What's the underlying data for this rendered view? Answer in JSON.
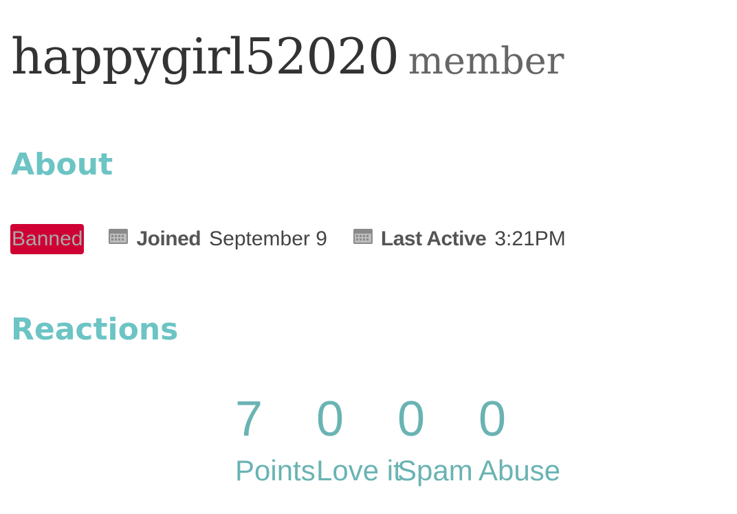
{
  "profile": {
    "username": "happygirl52020",
    "role": "member"
  },
  "about": {
    "title": "About",
    "badge": "Banned",
    "joined_label": "Joined",
    "joined_value": "September 9",
    "last_active_label": "Last Active",
    "last_active_value": "3:21PM",
    "icon": "calendar-icon"
  },
  "reactions": {
    "title": "Reactions",
    "stats": [
      {
        "value": "7",
        "label": "Points"
      },
      {
        "value": "0",
        "label": "Love it"
      },
      {
        "value": "0",
        "label": "Spam"
      },
      {
        "value": "0",
        "label": "Abuse"
      }
    ]
  },
  "colors": {
    "accent": "#6cc4c4",
    "stat": "#6ab3b3",
    "banned_bg": "#cf0033",
    "text_dark": "#333333"
  }
}
